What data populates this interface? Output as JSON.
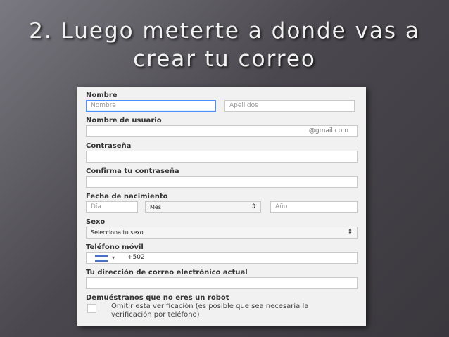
{
  "slide": {
    "title_line1": "2. Luego meterte a donde vas a",
    "title_line2": "crear tu correo"
  },
  "form": {
    "name_label": "Nombre",
    "first_name_placeholder": "Nombre",
    "last_name_placeholder": "Apellidos",
    "username_label": "Nombre de usuario",
    "username_suffix": "@gmail.com",
    "password_label": "Contraseña",
    "confirm_password_label": "Confirma tu contraseña",
    "birthdate_label": "Fecha de nacimiento",
    "day_placeholder": "Día",
    "month_value": "Mes",
    "year_placeholder": "Año",
    "gender_label": "Sexo",
    "gender_value": "Selecciona tu sexo",
    "phone_label": "Teléfono móvil",
    "phone_prefix": "+502",
    "current_email_label": "Tu dirección de correo electrónico actual",
    "robot_label": "Demuéstranos que no eres un robot",
    "skip_verification_text": "Omitir esta verificación (es posible que sea necesaria la verificación por teléfono)"
  },
  "icons": {
    "select_arrows": "⇕",
    "flag": "guatemala-flag-icon",
    "dropdown": "▾"
  },
  "colors": {
    "focus_border": "#4d90fe",
    "form_background": "#f1f1f1"
  }
}
